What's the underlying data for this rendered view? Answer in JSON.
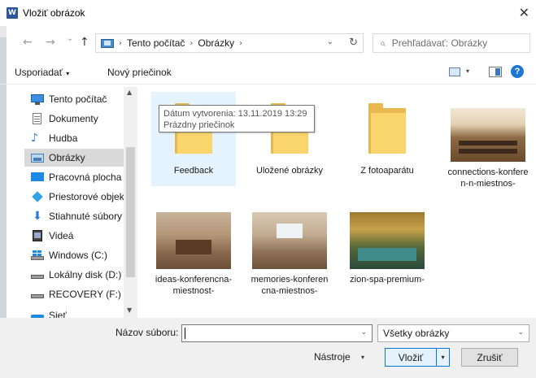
{
  "window": {
    "title": "Vložiť obrázok",
    "app_icon_letter": "W",
    "close_glyph": "✕"
  },
  "nav": {
    "back_glyph": "←",
    "forward_glyph": "→",
    "recent_glyph": "⌄",
    "up_glyph": "↑",
    "breadcrumb": [
      "Tento počítač",
      "Obrázky"
    ],
    "breadcrumb_sep": "›",
    "dropdown_glyph": "⌄",
    "refresh_glyph": "↻",
    "search_placeholder": "Prehľadávať: Obrázky",
    "search_glyph": "⌕"
  },
  "toolbar": {
    "organize": "Usporiadať",
    "organize_caret": "▾",
    "new_folder": "Nový priečinok",
    "view_caret": "▾",
    "help": "?"
  },
  "sidebar": {
    "up_glyph": "▲",
    "down_glyph": "▼",
    "items": [
      {
        "label": "Tento počítač",
        "icon": "pc-icon"
      },
      {
        "label": "Dokumenty",
        "icon": "documents-icon"
      },
      {
        "label": "Hudba",
        "icon": "music-icon"
      },
      {
        "label": "Obrázky",
        "icon": "pictures-icon",
        "selected": true
      },
      {
        "label": "Pracovná plocha",
        "icon": "desktop-icon"
      },
      {
        "label": "Priestorové objekty",
        "icon": "3d-objects-icon"
      },
      {
        "label": "Stiahnuté súbory",
        "icon": "downloads-icon"
      },
      {
        "label": "Videá",
        "icon": "videos-icon"
      },
      {
        "label": "Windows (C:)",
        "icon": "windows-drive-icon"
      },
      {
        "label": "Lokálny disk (D:)",
        "icon": "disk-icon"
      },
      {
        "label": "RECOVERY (F:)",
        "icon": "disk-icon"
      },
      {
        "label": "Sieť",
        "icon": "network-icon"
      }
    ]
  },
  "files": [
    {
      "label": "Feedback",
      "kind": "folder"
    },
    {
      "label": "Uložené obrázky",
      "kind": "folder"
    },
    {
      "label": "Z fotoaparátu",
      "kind": "folder"
    },
    {
      "label": "connections-konferen-n-miestnos-",
      "kind": "photo"
    },
    {
      "label": "ideas-konferencna-miestnost-",
      "kind": "photo"
    },
    {
      "label": "memories-konferencna-miestnos-",
      "kind": "photo"
    },
    {
      "label": "zion-spa-premium-",
      "kind": "photo"
    }
  ],
  "tooltip": {
    "line1": "Dátum vytvorenia: 13.11.2019 13:29",
    "line2": "Prázdny priečinok"
  },
  "bottom": {
    "filename_label": "Názov súboru:",
    "filename_value": "",
    "filename_drop": "⌄",
    "filetype": "Všetky obrázky",
    "filetype_drop": "⌄",
    "tools": "Nástroje",
    "tools_caret": "▾",
    "insert": "Vložiť",
    "insert_split": "▾",
    "cancel": "Zrušiť"
  }
}
